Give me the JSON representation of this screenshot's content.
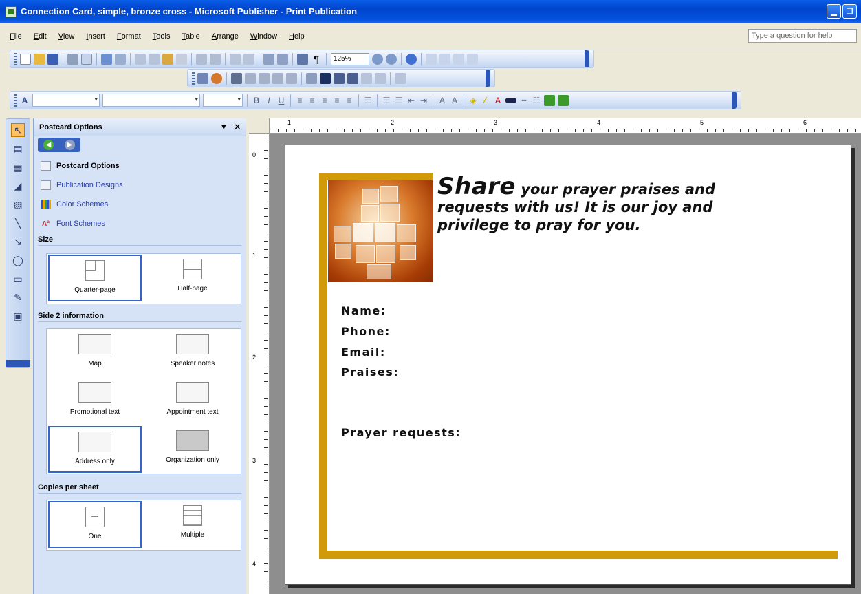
{
  "window": {
    "title": "Connection Card, simple, bronze cross - Microsoft Publisher - Print Publication"
  },
  "menu": {
    "items": [
      "File",
      "Edit",
      "View",
      "Insert",
      "Format",
      "Tools",
      "Table",
      "Arrange",
      "Window",
      "Help"
    ],
    "help_placeholder": "Type a question for help"
  },
  "toolbar": {
    "zoom": "125%"
  },
  "task_pane": {
    "title": "Postcard Options",
    "links": [
      "Postcard Options",
      "Publication Designs",
      "Color Schemes",
      "Font Schemes"
    ],
    "size": {
      "heading": "Size",
      "options": [
        "Quarter-page",
        "Half-page"
      ],
      "selected": "Quarter-page"
    },
    "side2": {
      "heading": "Side 2 information",
      "options": [
        "Map",
        "Speaker notes",
        "Promotional text",
        "Appointment text",
        "Address only",
        "Organization only"
      ],
      "selected": "Address only"
    },
    "copies": {
      "heading": "Copies per sheet",
      "options": [
        "One",
        "Multiple"
      ],
      "selected": "One"
    }
  },
  "rulers": {
    "horizontal": [
      "1",
      "2",
      "3",
      "4",
      "5",
      "6"
    ],
    "vertical": [
      "0",
      "1",
      "2",
      "3",
      "4"
    ]
  },
  "card": {
    "headline_big": "Share",
    "headline_rest": "your prayer praises and requests with us! It is our joy and privilege to pray for you.",
    "fields": [
      "Name:",
      "Phone:",
      "Email:",
      "Praises:",
      "Prayer requests:"
    ],
    "accent_color": "#d19a08"
  }
}
